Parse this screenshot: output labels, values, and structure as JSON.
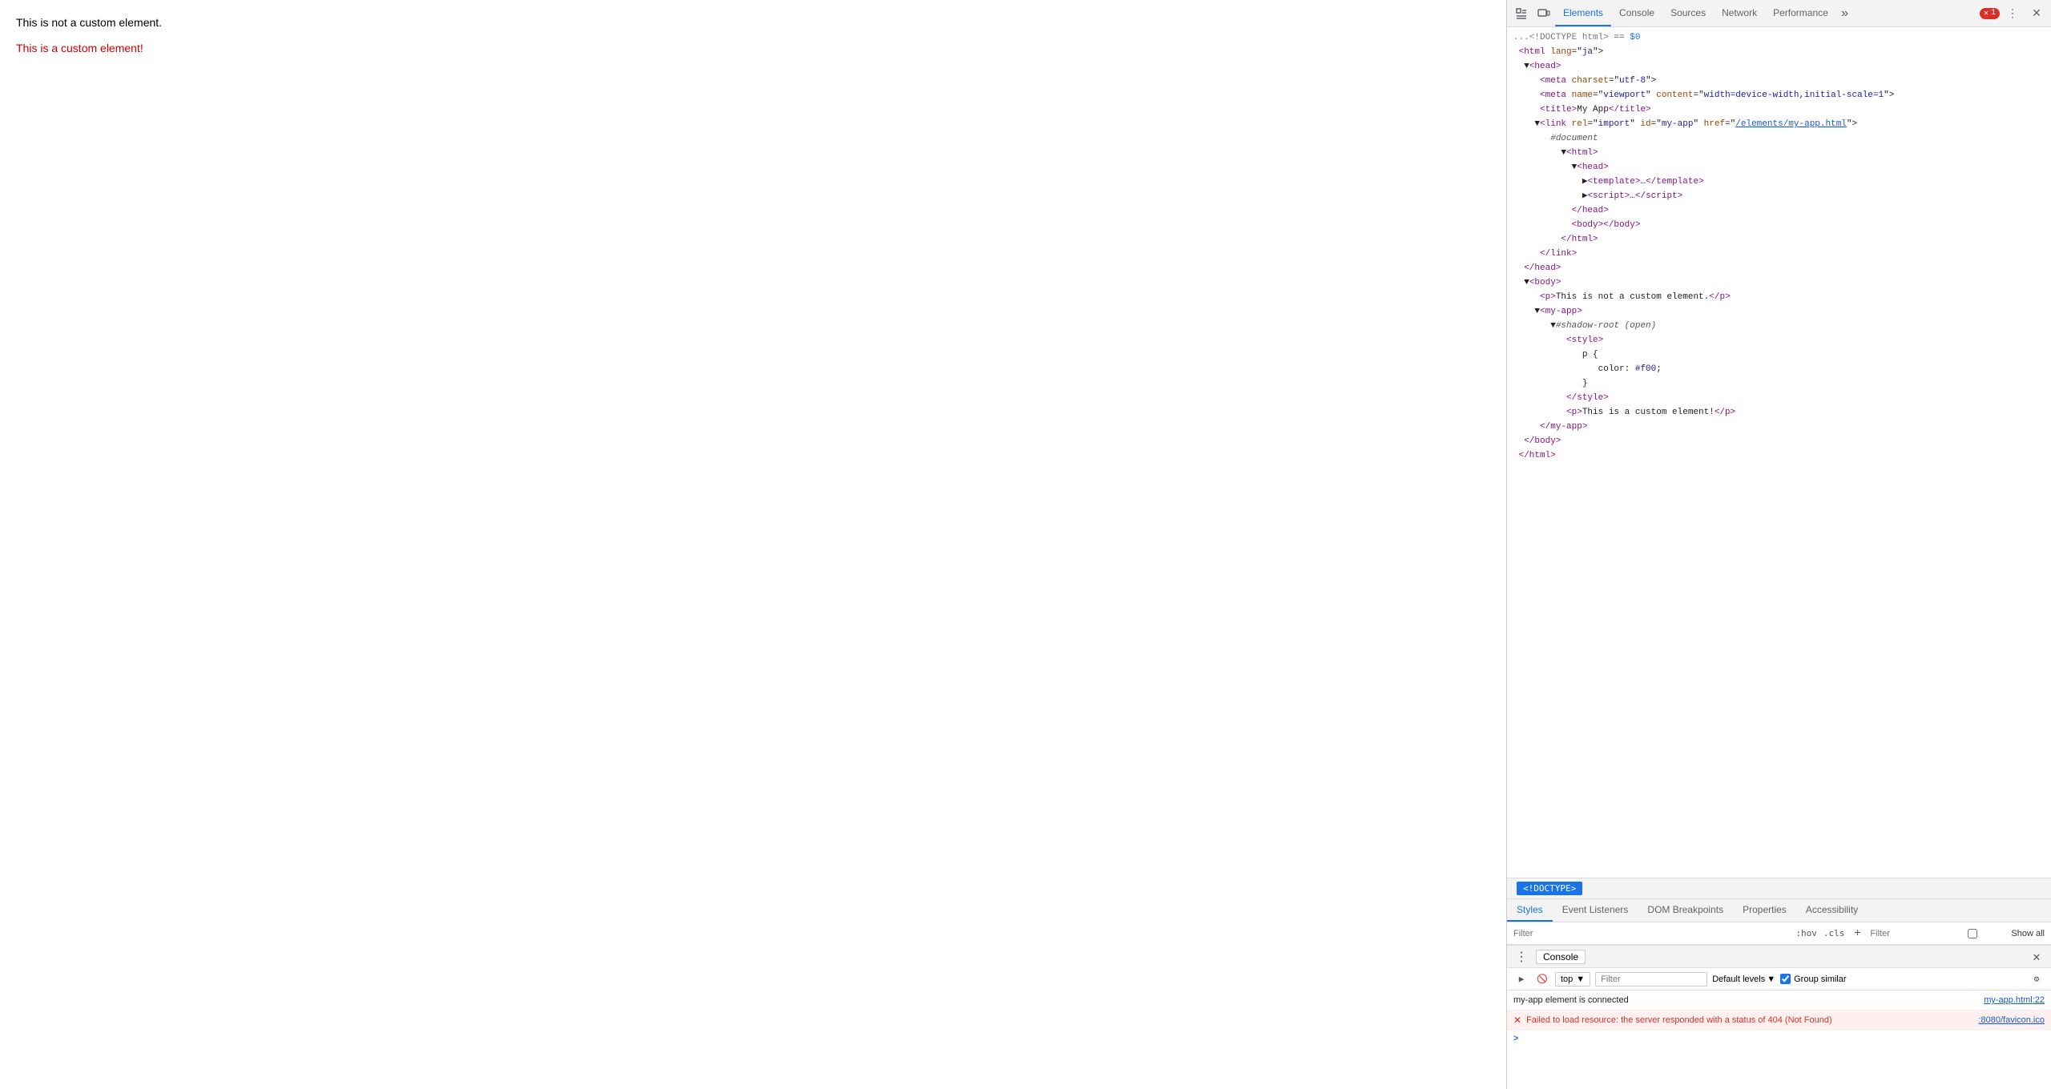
{
  "page": {
    "text1": "This is not a custom element.",
    "text2": "This is a custom element!"
  },
  "devtools": {
    "tabs": [
      {
        "label": "Elements",
        "active": true
      },
      {
        "label": "Console",
        "active": false
      },
      {
        "label": "Sources",
        "active": false
      },
      {
        "label": "Network",
        "active": false
      },
      {
        "label": "Performance",
        "active": false
      }
    ],
    "more_tabs_icon": "»",
    "error_count": "1",
    "close_icon": "✕",
    "more_icon": "⋮",
    "inspect_icon": "⬚",
    "device_icon": "▭"
  },
  "dom_tree": {
    "doctype_line": "...<!DOCTYPE html> == $0",
    "lines": []
  },
  "selected_tag": "<!DOCTYPE>",
  "sub_tabs": [
    {
      "label": "Styles",
      "active": true
    },
    {
      "label": "Event Listeners",
      "active": false
    },
    {
      "label": "DOM Breakpoints",
      "active": false
    },
    {
      "label": "Properties",
      "active": false
    },
    {
      "label": "Accessibility",
      "active": false
    }
  ],
  "styles_filter": {
    "placeholder": "Filter",
    "hov_label": ":hov",
    "cls_label": ".cls",
    "right_filter_placeholder": "Filter",
    "show_all_label": "Show all"
  },
  "console_drawer": {
    "title": "Console",
    "context": "top",
    "filter_placeholder": "Filter",
    "default_levels": "Default levels",
    "group_similar": "Group similar",
    "messages": [
      {
        "type": "info",
        "text": "my-app element is connected",
        "link": "my-app.html:22",
        "has_error_icon": false
      },
      {
        "type": "error",
        "text": "Failed to load resource: the server responded with a status of 404 (Not Found)",
        "link": ":8080/favicon.ico",
        "has_error_icon": true
      }
    ],
    "prompt": ">"
  }
}
